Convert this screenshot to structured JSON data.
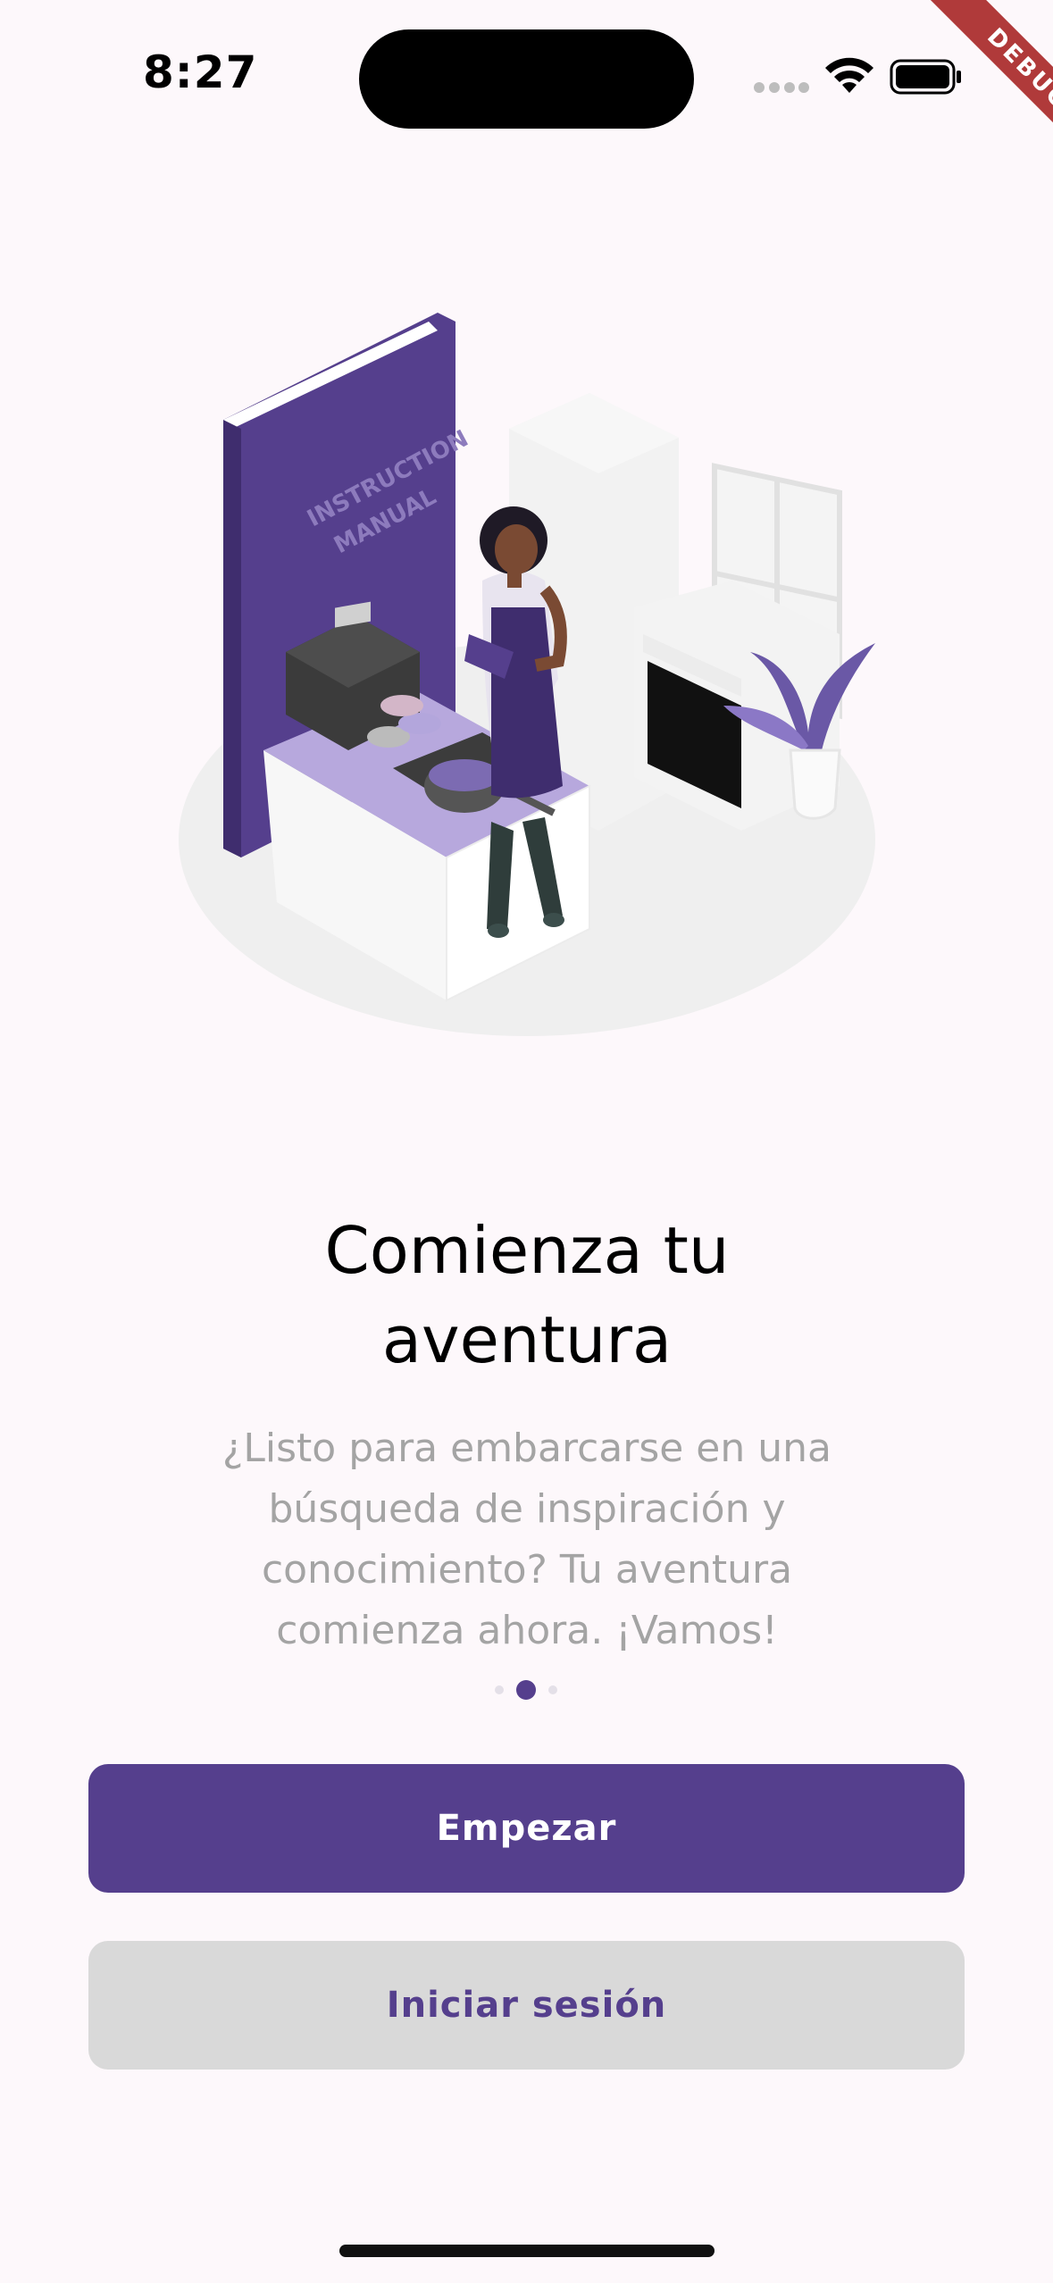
{
  "status_bar": {
    "time": "8:27",
    "signal_icon": "cellular-signal-icon",
    "wifi_icon": "wifi-icon",
    "battery_icon": "battery-full-icon",
    "debug_banner": "DEBUG"
  },
  "illustration": {
    "book_text_line1": "INSTRUCTION",
    "book_text_line2": "MANUAL"
  },
  "onboarding": {
    "title_line1": "Comienza tu",
    "title_line2": "aventura",
    "subtitle_lines": [
      "¿Listo para embarcarse en una",
      "búsqueda de inspiración y",
      "conocimiento? Tu aventura",
      "comienza ahora. ¡Vamos!"
    ],
    "page_indicator": {
      "total": 3,
      "active_index": 1
    }
  },
  "actions": {
    "primary_label": "Empezar",
    "secondary_label": "Iniciar sesión"
  },
  "colors": {
    "accent": "#553f8d",
    "background": "#fdf8fb",
    "secondary_button": "#d9d9d9",
    "subtitle_text": "#a4a4a4",
    "debug_ribbon": "#b03a3a"
  }
}
